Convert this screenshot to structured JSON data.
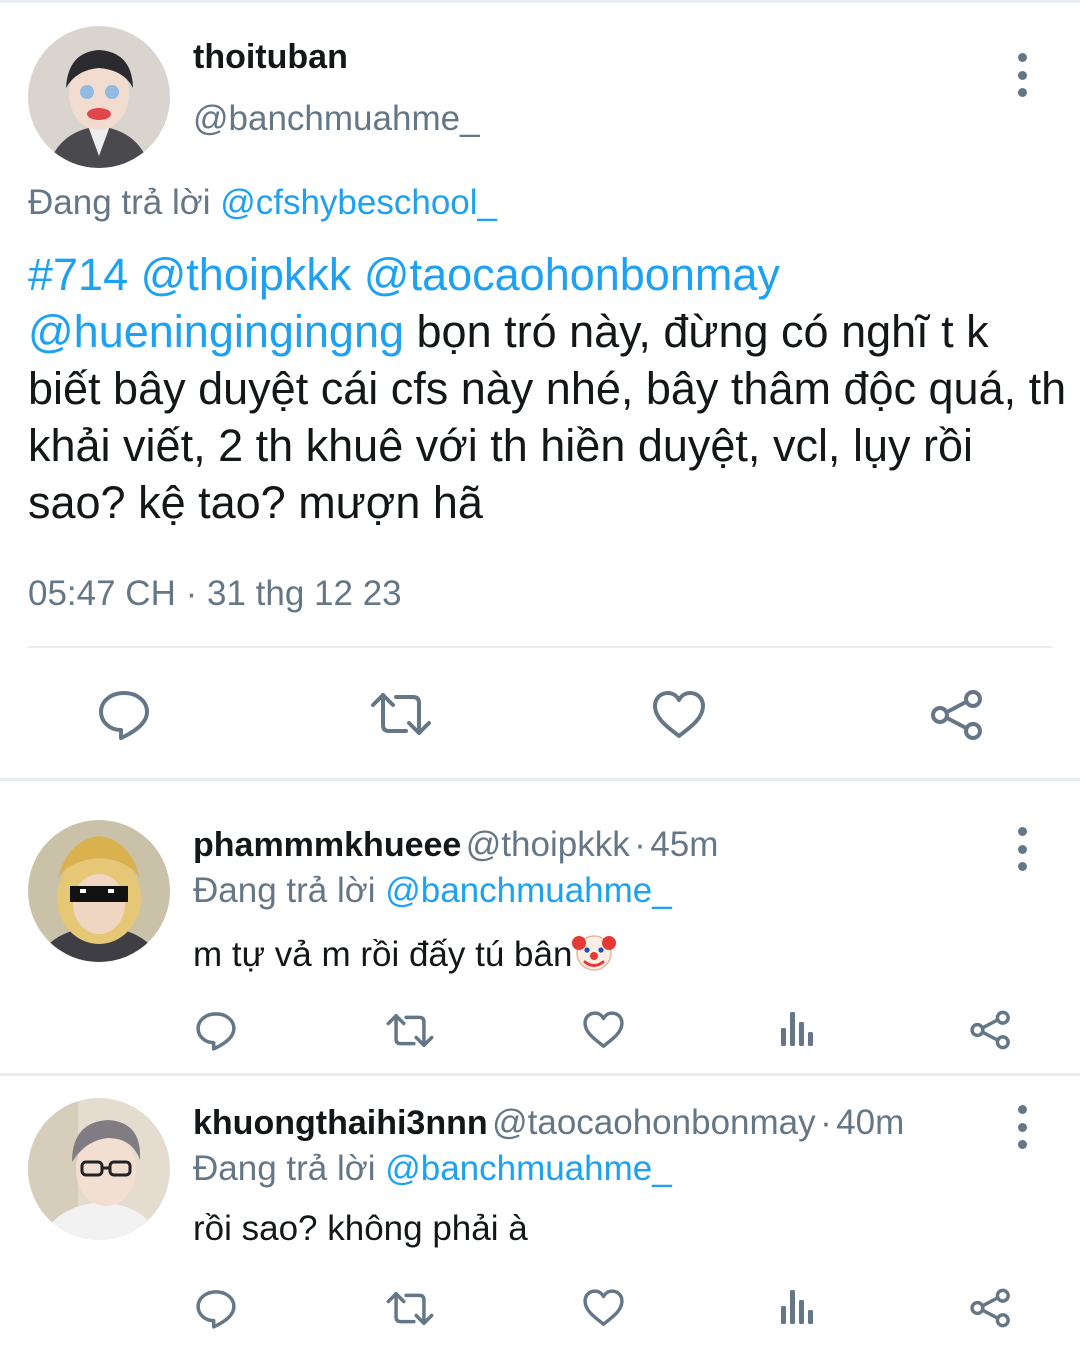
{
  "main_tweet": {
    "display_name": "thoituban",
    "handle": "@banchmuahme_",
    "replying_label": "Đang trả lời",
    "replying_to": "@cfshybeschool_",
    "hashtag": "#714",
    "mention_1": "@thoipkkk",
    "mention_2": "@taocaohonbonmay",
    "mention_3": "@hueningingingng",
    "text": "bọn tró này, đừng có nghĩ t k biết bây duyệt cái cfs này nhé, bây thâm độc quá, th khải viết, 2 th khuê với th hiền duyệt, vcl, lụy rồi sao? kệ tao? mượn hã",
    "time": "05:47 CH",
    "separator": "·",
    "date": "31 thg 12 23",
    "actions": [
      "reply-icon",
      "retweet-icon",
      "like-icon",
      "share-icon"
    ]
  },
  "replies": [
    {
      "display_name": "phammmkhueee",
      "handle": "@thoipkkk",
      "separator": "·",
      "age": "45m",
      "replying_label": "Đang trả lời",
      "replying_to": "@banchmuahme_",
      "text": "m tự vả m rồi đấy tú bân",
      "emoji": "clown-face",
      "actions": [
        "reply-icon",
        "retweet-icon",
        "like-icon",
        "analytics-icon",
        "share-icon"
      ]
    },
    {
      "display_name": "khuongthaihi3nnn",
      "handle": "@taocaohonbonmay",
      "separator": "·",
      "age": "40m",
      "replying_label": "Đang trả lời",
      "replying_to": "@banchmuahme_",
      "text": "rồi sao? không phải à",
      "actions": [
        "reply-icon",
        "retweet-icon",
        "like-icon",
        "analytics-icon",
        "share-icon"
      ]
    }
  ],
  "colors": {
    "link": "#1da1f2",
    "secondary_text": "#657786",
    "divider": "#e6ecf0"
  }
}
